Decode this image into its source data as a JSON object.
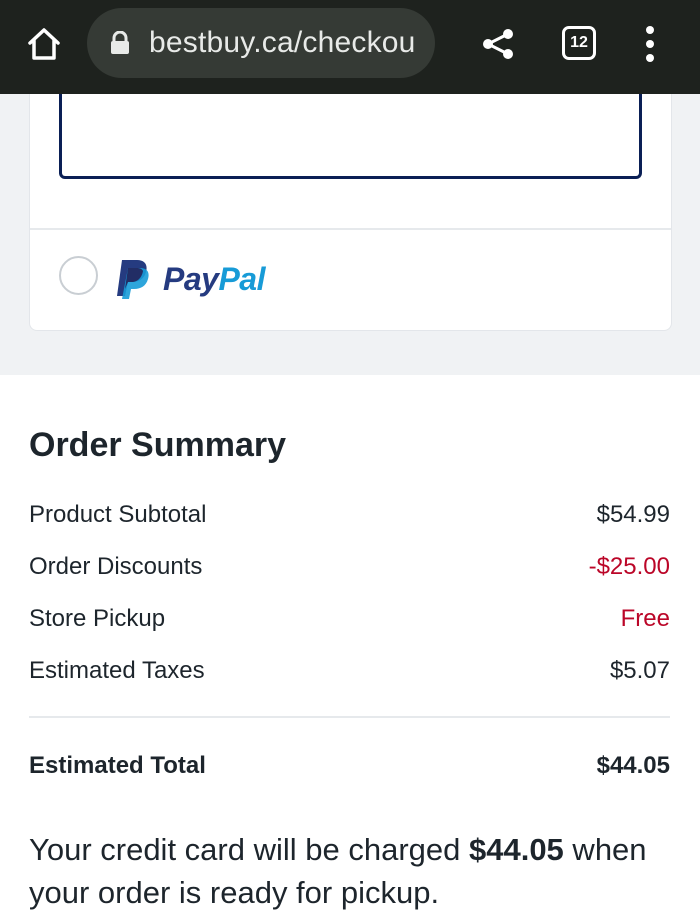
{
  "browser": {
    "url": "bestbuy.ca/checkou",
    "tab_count": "12",
    "icons": [
      "home-icon",
      "lock-icon",
      "share-icon",
      "tabs-icon",
      "more-vert-icon"
    ]
  },
  "payment": {
    "paypal_label_pay": "Pay",
    "paypal_label_pal": "Pal",
    "paypal_selected": false
  },
  "summary": {
    "title": "Order Summary",
    "rows": [
      {
        "label": "Product Subtotal",
        "value": "$54.99"
      },
      {
        "label": "Order Discounts",
        "value": "-$25.00"
      },
      {
        "label": "Store Pickup",
        "value": "Free"
      },
      {
        "label": "Estimated Taxes",
        "value": "$5.07"
      }
    ],
    "total_label": "Estimated Total",
    "total_value": "$44.05",
    "note_prefix": "Your credit card will be charged ",
    "note_amount": "$44.05",
    "note_suffix": " when your order is ready for pickup."
  },
  "colors": {
    "browser_bar": "#1e221e",
    "paypal_dark": "#253b80",
    "paypal_light": "#179bd7",
    "discount_red": "#bb0628",
    "input_border": "#0a1f55"
  }
}
